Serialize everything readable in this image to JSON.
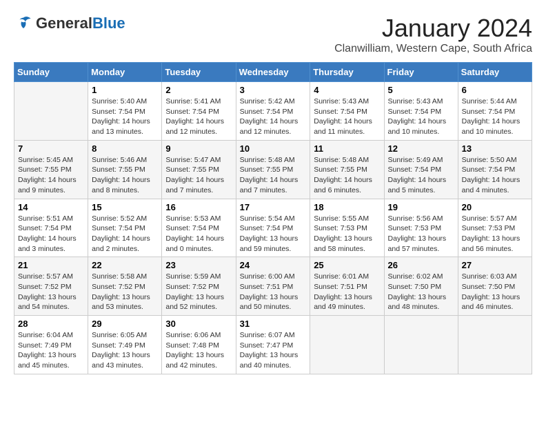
{
  "header": {
    "logo_general": "General",
    "logo_blue": "Blue",
    "title": "January 2024",
    "subtitle": "Clanwilliam, Western Cape, South Africa"
  },
  "weekdays": [
    "Sunday",
    "Monday",
    "Tuesday",
    "Wednesday",
    "Thursday",
    "Friday",
    "Saturday"
  ],
  "weeks": [
    [
      {
        "num": "",
        "sunrise": "",
        "sunset": "",
        "daylight": ""
      },
      {
        "num": "1",
        "sunrise": "5:40 AM",
        "sunset": "7:54 PM",
        "daylight": "14 hours and 13 minutes."
      },
      {
        "num": "2",
        "sunrise": "5:41 AM",
        "sunset": "7:54 PM",
        "daylight": "14 hours and 12 minutes."
      },
      {
        "num": "3",
        "sunrise": "5:42 AM",
        "sunset": "7:54 PM",
        "daylight": "14 hours and 12 minutes."
      },
      {
        "num": "4",
        "sunrise": "5:43 AM",
        "sunset": "7:54 PM",
        "daylight": "14 hours and 11 minutes."
      },
      {
        "num": "5",
        "sunrise": "5:43 AM",
        "sunset": "7:54 PM",
        "daylight": "14 hours and 10 minutes."
      },
      {
        "num": "6",
        "sunrise": "5:44 AM",
        "sunset": "7:54 PM",
        "daylight": "14 hours and 10 minutes."
      }
    ],
    [
      {
        "num": "7",
        "sunrise": "5:45 AM",
        "sunset": "7:55 PM",
        "daylight": "14 hours and 9 minutes."
      },
      {
        "num": "8",
        "sunrise": "5:46 AM",
        "sunset": "7:55 PM",
        "daylight": "14 hours and 8 minutes."
      },
      {
        "num": "9",
        "sunrise": "5:47 AM",
        "sunset": "7:55 PM",
        "daylight": "14 hours and 7 minutes."
      },
      {
        "num": "10",
        "sunrise": "5:48 AM",
        "sunset": "7:55 PM",
        "daylight": "14 hours and 7 minutes."
      },
      {
        "num": "11",
        "sunrise": "5:48 AM",
        "sunset": "7:55 PM",
        "daylight": "14 hours and 6 minutes."
      },
      {
        "num": "12",
        "sunrise": "5:49 AM",
        "sunset": "7:54 PM",
        "daylight": "14 hours and 5 minutes."
      },
      {
        "num": "13",
        "sunrise": "5:50 AM",
        "sunset": "7:54 PM",
        "daylight": "14 hours and 4 minutes."
      }
    ],
    [
      {
        "num": "14",
        "sunrise": "5:51 AM",
        "sunset": "7:54 PM",
        "daylight": "14 hours and 3 minutes."
      },
      {
        "num": "15",
        "sunrise": "5:52 AM",
        "sunset": "7:54 PM",
        "daylight": "14 hours and 2 minutes."
      },
      {
        "num": "16",
        "sunrise": "5:53 AM",
        "sunset": "7:54 PM",
        "daylight": "14 hours and 0 minutes."
      },
      {
        "num": "17",
        "sunrise": "5:54 AM",
        "sunset": "7:54 PM",
        "daylight": "13 hours and 59 minutes."
      },
      {
        "num": "18",
        "sunrise": "5:55 AM",
        "sunset": "7:53 PM",
        "daylight": "13 hours and 58 minutes."
      },
      {
        "num": "19",
        "sunrise": "5:56 AM",
        "sunset": "7:53 PM",
        "daylight": "13 hours and 57 minutes."
      },
      {
        "num": "20",
        "sunrise": "5:57 AM",
        "sunset": "7:53 PM",
        "daylight": "13 hours and 56 minutes."
      }
    ],
    [
      {
        "num": "21",
        "sunrise": "5:57 AM",
        "sunset": "7:52 PM",
        "daylight": "13 hours and 54 minutes."
      },
      {
        "num": "22",
        "sunrise": "5:58 AM",
        "sunset": "7:52 PM",
        "daylight": "13 hours and 53 minutes."
      },
      {
        "num": "23",
        "sunrise": "5:59 AM",
        "sunset": "7:52 PM",
        "daylight": "13 hours and 52 minutes."
      },
      {
        "num": "24",
        "sunrise": "6:00 AM",
        "sunset": "7:51 PM",
        "daylight": "13 hours and 50 minutes."
      },
      {
        "num": "25",
        "sunrise": "6:01 AM",
        "sunset": "7:51 PM",
        "daylight": "13 hours and 49 minutes."
      },
      {
        "num": "26",
        "sunrise": "6:02 AM",
        "sunset": "7:50 PM",
        "daylight": "13 hours and 48 minutes."
      },
      {
        "num": "27",
        "sunrise": "6:03 AM",
        "sunset": "7:50 PM",
        "daylight": "13 hours and 46 minutes."
      }
    ],
    [
      {
        "num": "28",
        "sunrise": "6:04 AM",
        "sunset": "7:49 PM",
        "daylight": "13 hours and 45 minutes."
      },
      {
        "num": "29",
        "sunrise": "6:05 AM",
        "sunset": "7:49 PM",
        "daylight": "13 hours and 43 minutes."
      },
      {
        "num": "30",
        "sunrise": "6:06 AM",
        "sunset": "7:48 PM",
        "daylight": "13 hours and 42 minutes."
      },
      {
        "num": "31",
        "sunrise": "6:07 AM",
        "sunset": "7:47 PM",
        "daylight": "13 hours and 40 minutes."
      },
      {
        "num": "",
        "sunrise": "",
        "sunset": "",
        "daylight": ""
      },
      {
        "num": "",
        "sunrise": "",
        "sunset": "",
        "daylight": ""
      },
      {
        "num": "",
        "sunrise": "",
        "sunset": "",
        "daylight": ""
      }
    ]
  ],
  "labels": {
    "sunrise_prefix": "Sunrise: ",
    "sunset_prefix": "Sunset: ",
    "daylight_prefix": "Daylight: "
  }
}
